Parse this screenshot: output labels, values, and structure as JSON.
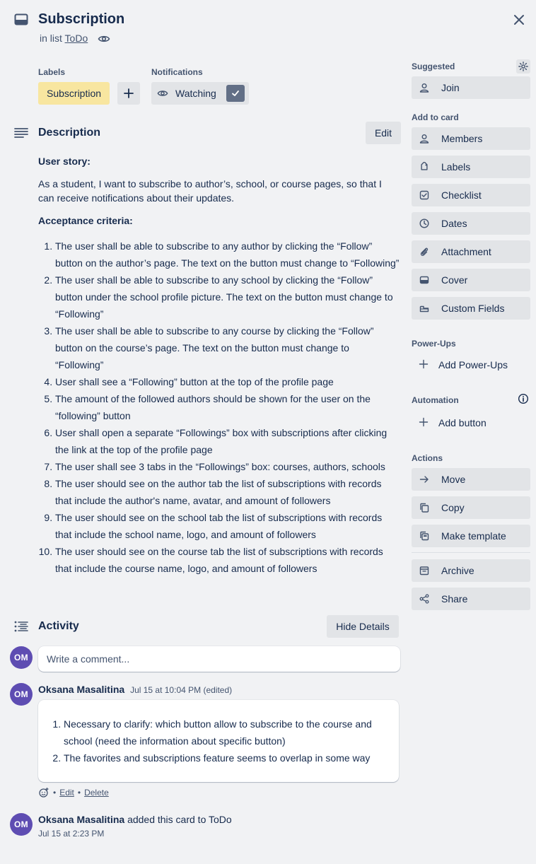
{
  "card": {
    "title": "Subscription",
    "in_list_prefix": "in list",
    "list_name": "ToDo"
  },
  "labels": {
    "heading": "Labels",
    "items": [
      "Subscription"
    ]
  },
  "notifications": {
    "heading": "Notifications",
    "watch_label": "Watching"
  },
  "description": {
    "heading": "Description",
    "edit_label": "Edit",
    "user_story_heading": "User story:",
    "user_story": "As a student, I want to subscribe to author’s, school, or course pages, so that I can receive notifications about their updates.",
    "criteria_heading": "Acceptance criteria:",
    "criteria": [
      "The user shall be able to subscribe to any author by clicking the “Follow” button on the author’s page. The text on the button must change to “Following”",
      "The user shall be able to subscribe to any school by clicking the “Follow” button under the school profile picture. The text on the button must change to “Following”",
      "The user shall be able to subscribe to any course by clicking the “Follow” button on the course’s page. The text on the button must change to “Following”",
      "User shall see a “Following” button at the top of the profile page",
      "The amount of the followed authors should be shown for the user on the “following” button",
      "User shall open a separate “Followings” box with subscriptions after clicking the link at the top of the profile page",
      "The user shall see 3 tabs in the “Followings” box: courses, authors, schools",
      "The user should see on the author tab the list of subscriptions with records that include the author's name, avatar, and amount of followers",
      "The user should see on the school tab the list of subscriptions with records that include the school name, logo, and amount of followers",
      "The user should see on the course tab the list of subscriptions with records that include the course name, logo, and amount of followers"
    ]
  },
  "activity": {
    "heading": "Activity",
    "hide_details_label": "Hide Details",
    "comment_placeholder": "Write a comment...",
    "current_user_initials": "OM",
    "comment": {
      "initials": "OM",
      "author": "Oksana Masalitina",
      "timestamp": "Jul 15 at 10:04 PM (edited)",
      "items": [
        "Necessary to clarify: which button allow to subscribe to the course and school (need the information about specific button)",
        "The favorites and subscriptions feature seems to overlap in some way"
      ],
      "edit_label": "Edit",
      "delete_label": "Delete",
      "separator": "•"
    },
    "event": {
      "initials": "OM",
      "author": "Oksana Masalitina",
      "text": "added this card to ToDo",
      "timestamp": "Jul 15 at 2:23 PM"
    }
  },
  "sidebar": {
    "suggested_heading": "Suggested",
    "join_label": "Join",
    "add_to_card_heading": "Add to card",
    "add_to_card": [
      {
        "label": "Members",
        "icon": "person-icon"
      },
      {
        "label": "Labels",
        "icon": "tag-icon"
      },
      {
        "label": "Checklist",
        "icon": "checklist-icon"
      },
      {
        "label": "Dates",
        "icon": "clock-icon"
      },
      {
        "label": "Attachment",
        "icon": "paperclip-icon"
      },
      {
        "label": "Cover",
        "icon": "cover-icon"
      },
      {
        "label": "Custom Fields",
        "icon": "custom-fields-icon"
      }
    ],
    "powerups_heading": "Power-Ups",
    "add_powerups_label": "Add Power-Ups",
    "automation_heading": "Automation",
    "add_button_label": "Add button",
    "actions_heading": "Actions",
    "actions": [
      {
        "label": "Move",
        "icon": "arrow-right-icon"
      },
      {
        "label": "Copy",
        "icon": "copy-icon"
      },
      {
        "label": "Make template",
        "icon": "template-icon"
      },
      {
        "label": "Archive",
        "icon": "archive-icon"
      },
      {
        "label": "Share",
        "icon": "share-icon"
      }
    ]
  },
  "colors": {
    "label_yellow": "#f8e6a0",
    "avatar_purple": "#5e4db2",
    "button_gray": "#e2e4e7",
    "background": "#f1f2f4"
  }
}
